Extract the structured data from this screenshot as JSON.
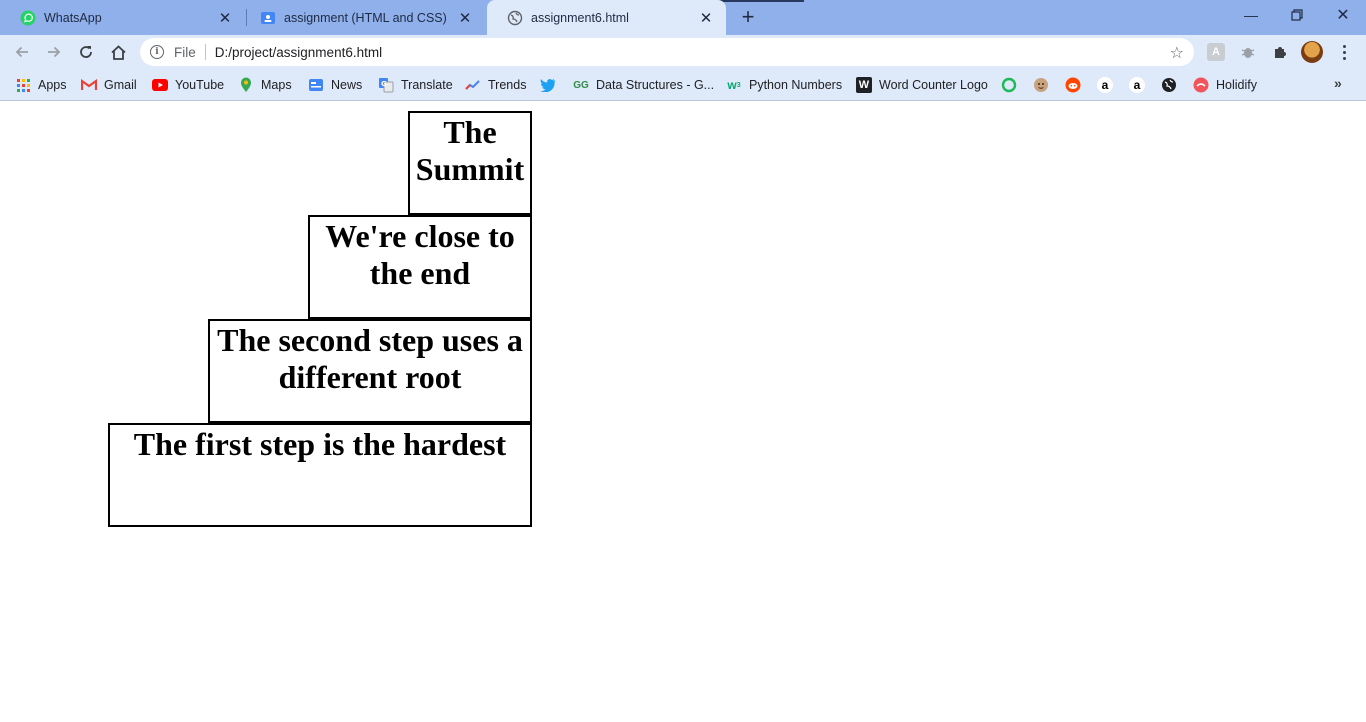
{
  "browser": {
    "tabs": [
      {
        "title": "WhatsApp",
        "icon": "whatsapp-icon",
        "active": false
      },
      {
        "title": "assignment (HTML and CSS)",
        "icon": "classroom-icon",
        "active": false
      },
      {
        "title": "assignment6.html",
        "icon": "globe-icon",
        "active": true
      }
    ],
    "address": {
      "scheme": "File",
      "url": "D:/project/assignment6.html"
    },
    "bookmarks": [
      {
        "label": "Apps",
        "icon": "apps-grid-icon"
      },
      {
        "label": "Gmail",
        "icon": "gmail-icon"
      },
      {
        "label": "YouTube",
        "icon": "youtube-icon"
      },
      {
        "label": "Maps",
        "icon": "maps-pin-icon"
      },
      {
        "label": "News",
        "icon": "news-icon"
      },
      {
        "label": "Translate",
        "icon": "translate-icon"
      },
      {
        "label": "Trends",
        "icon": "trends-icon"
      },
      {
        "label": "",
        "icon": "twitter-icon"
      },
      {
        "label": "Data Structures - G...",
        "icon": "geeksforgeeks-icon"
      },
      {
        "label": "Python Numbers",
        "icon": "w3schools-icon"
      },
      {
        "label": "Word Counter Logo",
        "icon": "wordcounter-icon"
      },
      {
        "label": "",
        "icon": "green-ring-icon"
      },
      {
        "label": "",
        "icon": "face-icon"
      },
      {
        "label": "",
        "icon": "reddit-icon"
      },
      {
        "label": "",
        "icon": "amazon-icon"
      },
      {
        "label": "",
        "icon": "amazon-icon"
      },
      {
        "label": "",
        "icon": "globe-icon"
      },
      {
        "label": "Holidify",
        "icon": "holidify-icon"
      }
    ]
  },
  "page": {
    "steps": [
      {
        "text": "The Summit"
      },
      {
        "text": "We're close to the end"
      },
      {
        "text": "The second step uses a different root"
      },
      {
        "text": "The first step is the hardest"
      }
    ]
  }
}
